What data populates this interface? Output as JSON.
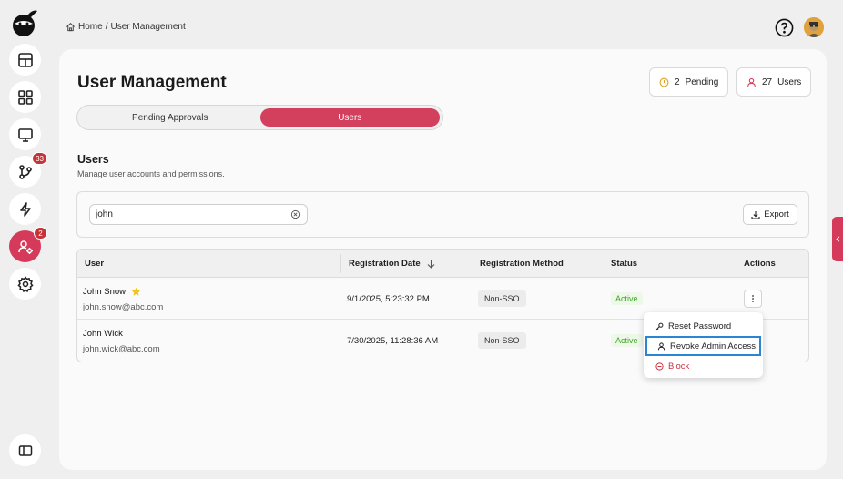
{
  "breadcrumb": {
    "home": "Home",
    "separator": "/",
    "current": "User Management"
  },
  "sidebar": {
    "items": [
      {
        "name": "dashboard",
        "icon": "layout-icon"
      },
      {
        "name": "apps",
        "icon": "grid-icon"
      },
      {
        "name": "monitor",
        "icon": "monitor-icon"
      },
      {
        "name": "workflows",
        "icon": "branch-icon",
        "badge": "33"
      },
      {
        "name": "automations",
        "icon": "lightning-icon"
      },
      {
        "name": "user-management",
        "icon": "user-gear-icon",
        "badge": "2",
        "active": true
      },
      {
        "name": "settings",
        "icon": "gear-icon"
      }
    ],
    "collapse_icon": "sidebar-toggle-icon"
  },
  "page": {
    "title": "User Management",
    "stats": {
      "pending_count": "2",
      "pending_label": "Pending",
      "users_count": "27",
      "users_label": "Users"
    },
    "tabs": [
      {
        "label": "Pending Approvals",
        "active": false
      },
      {
        "label": "Users",
        "active": true
      }
    ],
    "section_title": "Users",
    "section_subtitle": "Manage user accounts and permissions."
  },
  "filters": {
    "search_value": "john",
    "export_label": "Export"
  },
  "table": {
    "headers": [
      "User",
      "Registration Date",
      "Registration Method",
      "Status",
      "Actions"
    ],
    "rows": [
      {
        "name": "John Snow",
        "starred": true,
        "email": "john.snow@abc.com",
        "date": "9/1/2025, 5:23:32 PM",
        "method": "Non-SSO",
        "status": "Active"
      },
      {
        "name": "John Wick",
        "starred": false,
        "email": "john.wick@abc.com",
        "date": "7/30/2025, 11:28:36 AM",
        "method": "Non-SSO",
        "status": "Active"
      }
    ]
  },
  "action_menu": {
    "items": [
      {
        "label": "Reset Password",
        "icon": "key-icon"
      },
      {
        "label": "Revoke Admin Access",
        "icon": "user-icon",
        "highlighted": true
      },
      {
        "label": "Block",
        "icon": "block-icon",
        "danger": true
      }
    ]
  },
  "colors": {
    "accent": "#d3405e",
    "active_status": "#3ea52a",
    "danger": "#c6343f",
    "focus": "#2a86d4"
  }
}
